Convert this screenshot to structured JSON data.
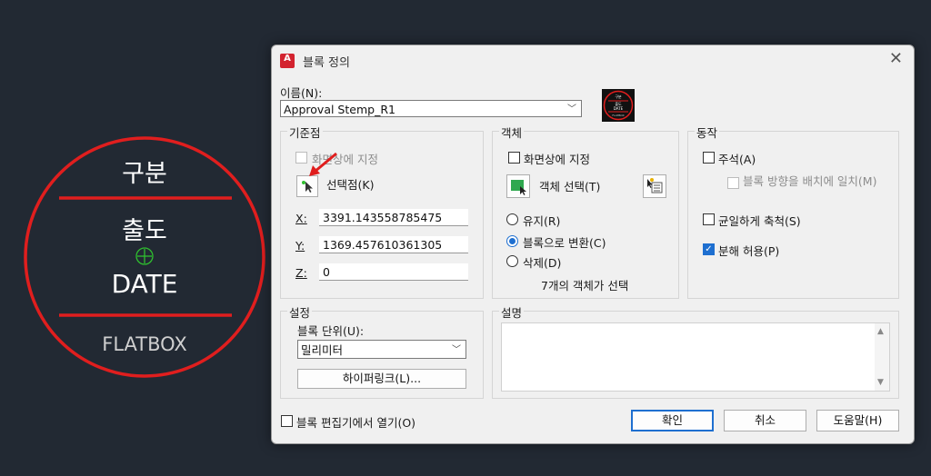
{
  "background": {
    "row1": "구분",
    "row2": "출도",
    "row3": "DATE",
    "row4": "FLATBOX",
    "accent_color": "#e01e1e",
    "snap_color": "#2fbf2f"
  },
  "dialog": {
    "app_icon": "A",
    "title": "블록 정의",
    "close_icon": "close-icon",
    "name_label": "이름(N):",
    "name_value": "Approval Stemp_R1",
    "preview_texts": [
      "구분",
      "출도",
      "DATE",
      "FLATBOX"
    ],
    "base_point": {
      "title": "기준점",
      "specify_on_screen": "화면상에 지정",
      "pick_point": "선택점(K)",
      "x_label": "X:",
      "x_value": "3391.143558785475",
      "y_label": "Y:",
      "y_value": "1369.457610361305",
      "z_label": "Z:",
      "z_value": "0"
    },
    "objects": {
      "title": "객체",
      "specify_on_screen": "화면상에 지정",
      "select_objects": "객체 선택(T)",
      "retain": "유지(R)",
      "convert_to_block": "블록으로 변환(C)",
      "delete": "삭제(D)",
      "selected_count": "7개의 객체가 선택"
    },
    "behavior": {
      "title": "동작",
      "annotative": "주석(A)",
      "match_orientation": "블록 방향을 배치에 일치(M)",
      "scale_uniformly": "균일하게 축척(S)",
      "allow_exploding": "분해 허용(P)"
    },
    "settings": {
      "title": "설정",
      "block_unit_label": "블록 단위(U):",
      "block_unit_value": "밀리미터",
      "hyperlink": "하이퍼링크(L)..."
    },
    "description": {
      "title": "설명",
      "value": ""
    },
    "open_in_editor": "블록 편집기에서 열기(O)",
    "buttons": {
      "ok": "확인",
      "cancel": "취소",
      "help": "도움말(H)"
    },
    "accent": "#1e6fd0"
  }
}
